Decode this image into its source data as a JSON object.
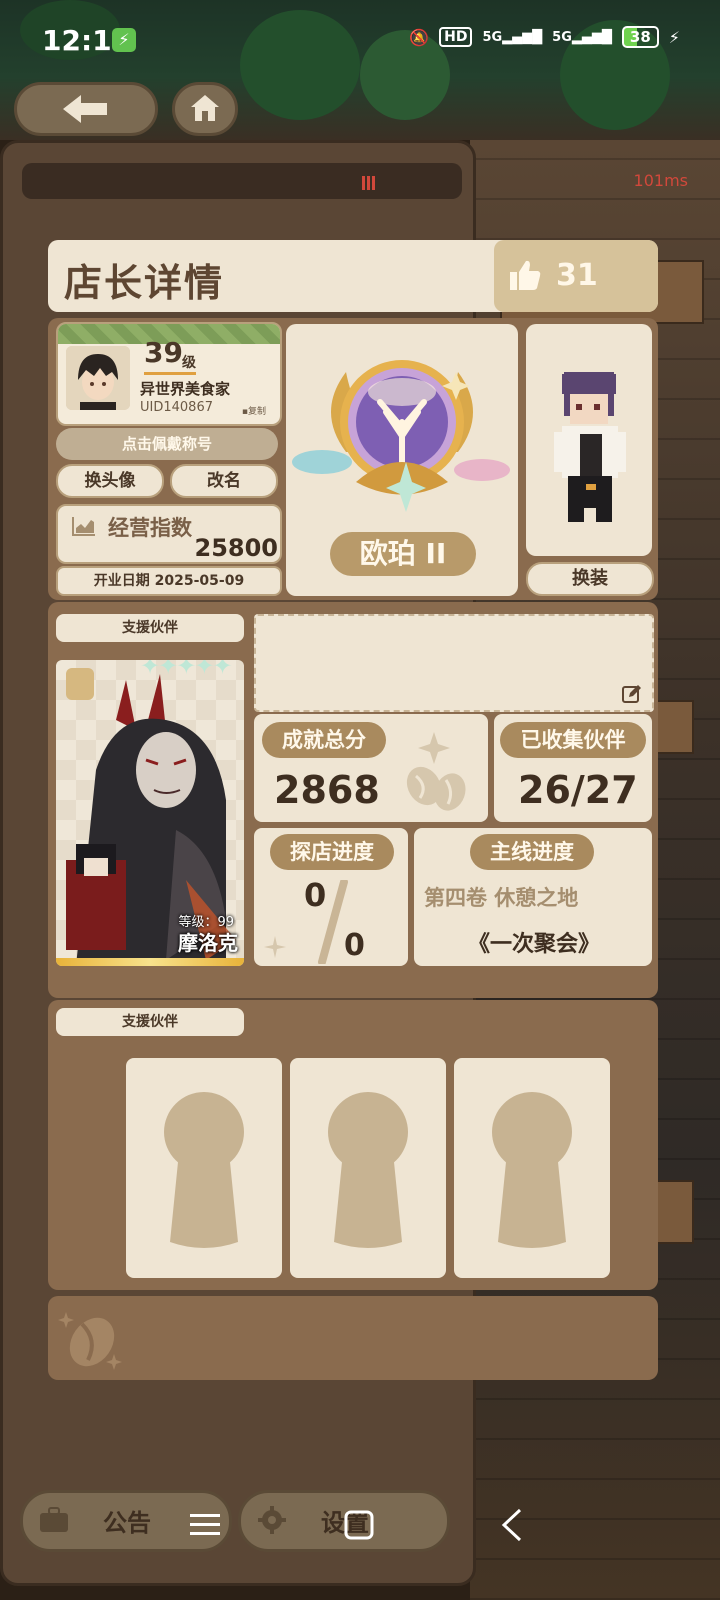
{
  "status_bar": {
    "time": "12:12",
    "network": "HD",
    "signal1": "5G",
    "signal2": "5G",
    "battery": "38"
  },
  "top_bar": {
    "back_icon": "back-arrow-icon",
    "home_icon": "home-icon",
    "ping": "101ms"
  },
  "panel": {
    "title": "店长详情",
    "likes": "31"
  },
  "profile": {
    "level": "39",
    "level_unit": "级",
    "name": "异世界美食家",
    "uid": "UID140867",
    "copy": "复制",
    "title_hint": "点击佩戴称号",
    "change_avatar": "换头像",
    "rename": "改名",
    "business_index_label": "经营指数",
    "business_index": "25800",
    "open_date": "开业日期 2025-05-09"
  },
  "rank": {
    "name": "欧珀 II"
  },
  "outfit": {
    "change_outfit": "换装"
  },
  "support_partner": {
    "label": "支援伙伴",
    "stars": "✦✦✦✦✦",
    "level": "等级：99",
    "name": "摩洛克"
  },
  "stats": {
    "achievement_label": "成就总分",
    "achievement_value": "2868",
    "collected_label": "已收集伙伴",
    "collected_value": "26/27",
    "explore_label": "探店进度",
    "explore_current": "0",
    "explore_total": "0",
    "main_label": "主线进度",
    "main_volume": "第四卷 休憩之地",
    "main_chapter": "《一次聚会》"
  },
  "support_slots": {
    "label": "支援伙伴",
    "count": 3
  },
  "bottom": {
    "announcement": "公告",
    "settings": "设置"
  },
  "colors": {
    "panel_bg": "#8a6b4e",
    "card_bg": "#efe5d3",
    "pill_bg": "#a98a5e",
    "text_dark": "#3e2e20"
  }
}
